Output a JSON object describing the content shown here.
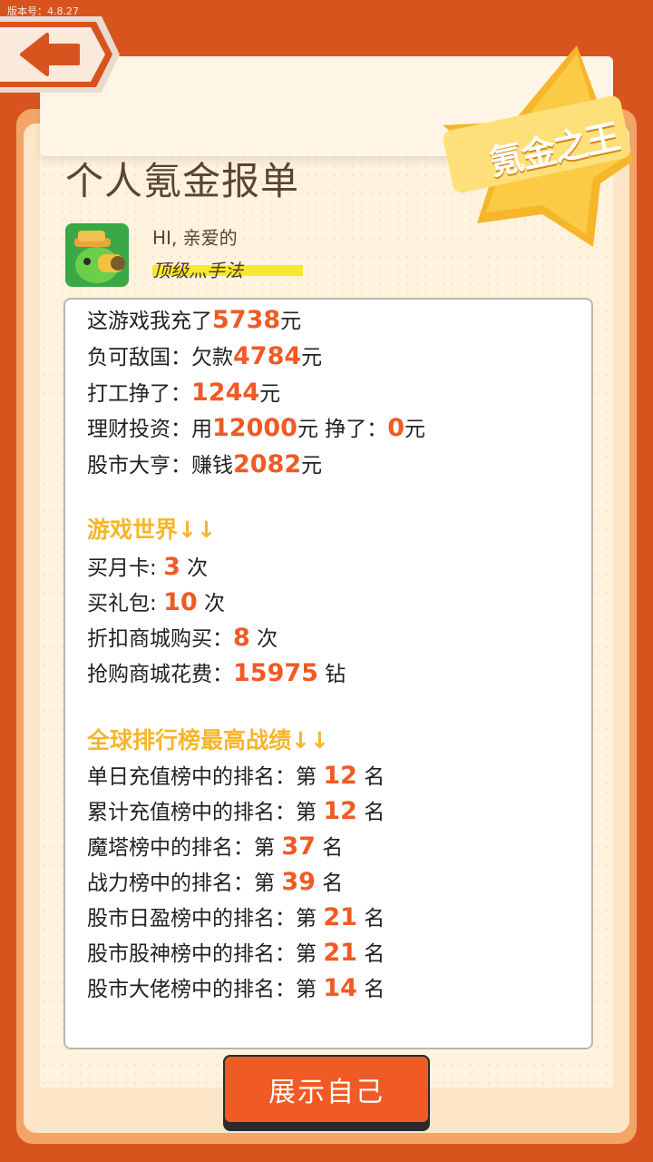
{
  "version_label": "版本号：4.8.27",
  "header": {
    "title": "个人氪金报单",
    "badge_text": "氪金之王"
  },
  "colors": {
    "accent": "#f05a24",
    "section": "#f5b62a",
    "frame": "#d8541f",
    "highlight": "#f5e92a"
  },
  "icons": {
    "back": "back-arrow-icon",
    "avatar": "avatar-icon"
  },
  "profile": {
    "greeting": "HI, 亲爱的",
    "rank_title": "顶级灬手法"
  },
  "stats": {
    "recharge": {
      "prefix": "这游戏我充了",
      "value": "5738",
      "unit": "元"
    },
    "debt": {
      "prefix": "负可敌国：欠款",
      "value": "4784",
      "unit": "元"
    },
    "work": {
      "prefix": "打工挣了：",
      "value": "1244",
      "unit": "元"
    },
    "invest": {
      "prefix": "理财投资：用",
      "value": "12000",
      "mid": "元 挣了：",
      "value2": "0",
      "unit": "元"
    },
    "stock": {
      "prefix": "股市大亨：赚钱",
      "value": "2082",
      "unit": "元"
    }
  },
  "game_world": {
    "heading": "游戏世界↓↓",
    "monthly_card": {
      "prefix": "买月卡: ",
      "value": "3",
      "unit": " 次"
    },
    "gift_pack": {
      "prefix": "买礼包: ",
      "value": "10",
      "unit": " 次"
    },
    "discount_shop": {
      "prefix": "折扣商城购买：",
      "value": "8",
      "unit": " 次"
    },
    "flash_shop": {
      "prefix": "抢购商城花费：",
      "value": "15975",
      "unit": " 钻"
    }
  },
  "leaderboards": {
    "heading": "全球排行榜最高战绩↓↓",
    "items": [
      {
        "prefix": "单日充值榜中的排名：第 ",
        "value": "12",
        "unit": " 名"
      },
      {
        "prefix": "累计充值榜中的排名：第 ",
        "value": "12",
        "unit": " 名"
      },
      {
        "prefix": "魔塔榜中的排名：第 ",
        "value": "37",
        "unit": " 名"
      },
      {
        "prefix": "战力榜中的排名：第 ",
        "value": "39",
        "unit": " 名"
      },
      {
        "prefix": "股市日盈榜中的排名：第 ",
        "value": "21",
        "unit": " 名"
      },
      {
        "prefix": "股市股神榜中的排名：第 ",
        "value": "21",
        "unit": " 名"
      },
      {
        "prefix": "股市大佬榜中的排名：第 ",
        "value": "14",
        "unit": " 名"
      }
    ]
  },
  "cta_label": "展示自己"
}
